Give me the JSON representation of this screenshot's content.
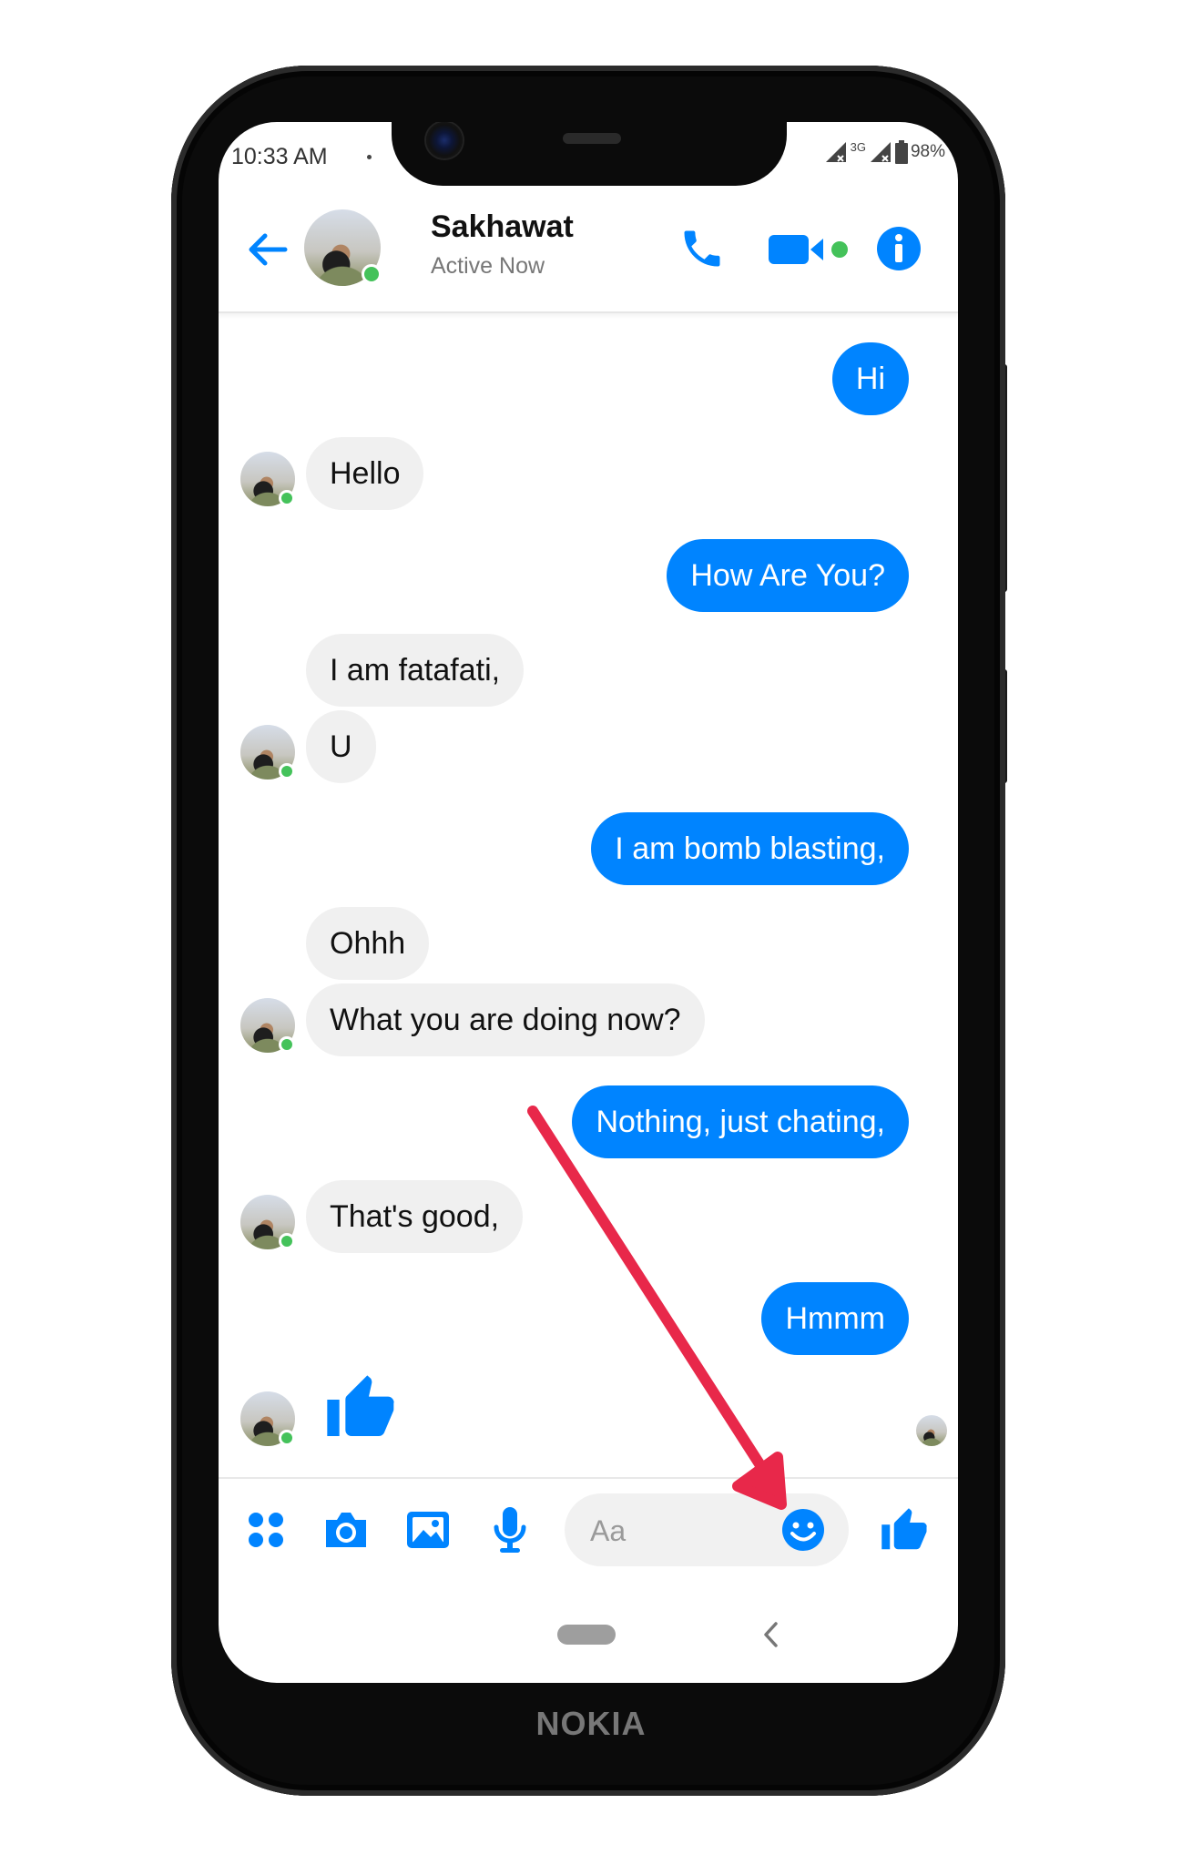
{
  "status_bar": {
    "time": "10:33 AM",
    "network": "3G",
    "battery": "98%"
  },
  "header": {
    "contact_name": "Sakhawat",
    "contact_status": "Active Now"
  },
  "messages": [
    {
      "dir": "out",
      "text": "Hi"
    },
    {
      "dir": "in",
      "text": "Hello"
    },
    {
      "dir": "out",
      "text": "How Are You?"
    },
    {
      "dir": "in",
      "text": "I am fatafati,"
    },
    {
      "dir": "in",
      "text": "U"
    },
    {
      "dir": "out",
      "text": "I am bomb blasting,"
    },
    {
      "dir": "in",
      "text": "Ohhh"
    },
    {
      "dir": "in",
      "text": "What you are doing now?"
    },
    {
      "dir": "out",
      "text": "Nothing, just chating,"
    },
    {
      "dir": "in",
      "text": "That's good,"
    },
    {
      "dir": "out",
      "text": "Hmmm"
    }
  ],
  "composer": {
    "placeholder": "Aa"
  },
  "brand": "NOKIA",
  "colors": {
    "accent": "#0084ff",
    "online": "#44c25a",
    "arrow": "#e8284a"
  }
}
